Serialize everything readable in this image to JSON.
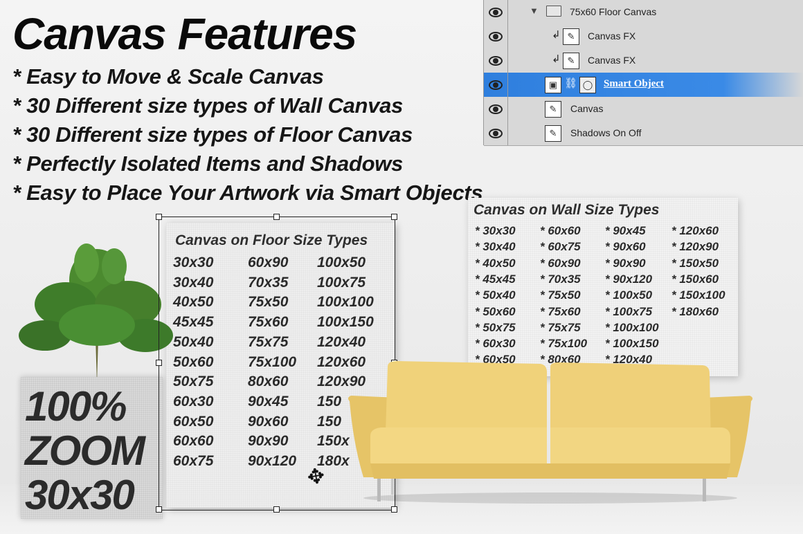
{
  "heading": "Canvas Features",
  "features": [
    "* Easy to Move & Scale Canvas",
    "* 30 Different size types of Wall Canvas",
    "* 30 Different size types of Floor Canvas",
    "* Perfectly Isolated Items and Shadows",
    "* Easy to Place Your Artwork via Smart Objects"
  ],
  "layers_panel": {
    "rows": [
      {
        "name": "75x60 Floor Canvas",
        "kind": "group",
        "selected": false
      },
      {
        "name": "Canvas FX",
        "kind": "clipped",
        "selected": false
      },
      {
        "name": "Canvas FX",
        "kind": "clipped",
        "selected": false
      },
      {
        "name": "Smart Object",
        "kind": "smart-object",
        "selected": true
      },
      {
        "name": "Canvas",
        "kind": "layer",
        "selected": false
      },
      {
        "name": "Shadows On Off",
        "kind": "layer",
        "selected": false
      }
    ],
    "selected_color": "#3a8ae6"
  },
  "floor_canvas": {
    "title": "Canvas on Floor Size Types",
    "col1": [
      "30x30",
      "30x40",
      "40x50",
      "45x45",
      "50x40",
      "50x60",
      "50x75",
      "60x30",
      "60x50",
      "60x60",
      "60x75"
    ],
    "col2": [
      "60x90",
      "70x35",
      "75x50",
      "75x60",
      "75x75",
      "75x100",
      "80x60",
      "90x45",
      "90x60",
      "90x90",
      "90x120"
    ],
    "col3": [
      "100x50",
      "100x75",
      "100x100",
      "100x150",
      "120x40",
      "120x60",
      "120x90",
      "150",
      "150",
      "150x",
      "180x"
    ]
  },
  "wall_canvas": {
    "title": "Canvas on Wall Size Types",
    "col1": [
      "* 30x30",
      "* 30x40",
      "* 40x50",
      "* 45x45",
      "* 50x40",
      "* 50x60",
      "* 50x75",
      "* 60x30",
      "* 60x50"
    ],
    "col2": [
      "* 60x60",
      "* 60x75",
      "* 60x90",
      "* 70x35",
      "* 75x50",
      "* 75x60",
      "* 75x75",
      "* 75x100",
      "* 80x60"
    ],
    "col3": [
      "* 90x45",
      "* 90x60",
      "* 90x90",
      "* 90x120",
      "* 100x50",
      "* 100x75",
      "* 100x100",
      "* 100x150",
      "* 120x40"
    ],
    "col4": [
      "* 120x60",
      "* 120x90",
      "* 150x50",
      "* 150x60",
      "* 150x100",
      "* 180x60"
    ]
  },
  "zoom_block": {
    "line1": "100%",
    "line2": "ZOOM",
    "line3": "30x30"
  },
  "icons": {
    "eye": "eye-icon",
    "folder": "folder-icon",
    "brush": "brush-icon",
    "smart_object": "smart-object-icon",
    "link": "chain-link-icon",
    "move": "move-cursor-icon"
  },
  "colors": {
    "sofa": "#f0d27a",
    "plant": "#3f7d2a",
    "text": "#111111"
  }
}
